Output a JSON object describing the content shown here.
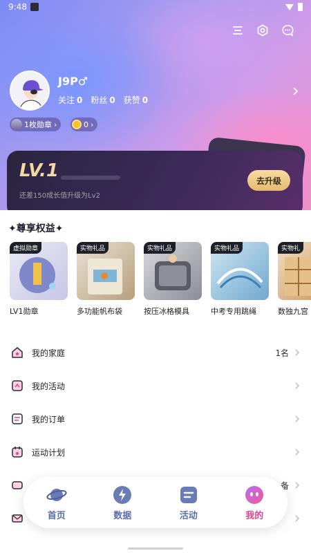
{
  "status_bar": {
    "time": "9:48"
  },
  "profile": {
    "username": "J9P♂",
    "stats": [
      {
        "label": "关注",
        "value": "0"
      },
      {
        "label": "粉丝",
        "value": "0"
      },
      {
        "label": "获赞",
        "value": "0"
      }
    ],
    "badge_pill": "1枚勋章",
    "coin_pill": "0"
  },
  "level": {
    "title": "LV.1",
    "subtitle": "还差150成长值升级为Lv2",
    "upgrade_label": "去升级"
  },
  "benefits": {
    "title": "尊享权益",
    "items": [
      {
        "tag": "虚拟勋章",
        "label": "LV1勋章",
        "color": "#7f88c9"
      },
      {
        "tag": "实物礼品",
        "label": "多功能帆布袋",
        "color": "#c9b79a"
      },
      {
        "tag": "实物礼品",
        "label": "按压冰格模具",
        "color": "#6d6f78"
      },
      {
        "tag": "实物礼品",
        "label": "中考专用跳绳",
        "color": "#7fb6d6"
      },
      {
        "tag": "实物礼",
        "label": "数独九宫",
        "color": "#d6a86a"
      }
    ]
  },
  "menu": [
    {
      "label": "我的家庭",
      "value": "1名"
    },
    {
      "label": "我的活动",
      "value": ""
    },
    {
      "label": "我的订单",
      "value": ""
    },
    {
      "label": "运动计划",
      "value": ""
    },
    {
      "label": "",
      "value": "备"
    },
    {
      "label": "",
      "value": ""
    }
  ],
  "nav": [
    {
      "label": "首页",
      "icon": "planet-icon"
    },
    {
      "label": "数据",
      "icon": "lightning-icon"
    },
    {
      "label": "活动",
      "icon": "activity-icon"
    },
    {
      "label": "我的",
      "icon": "face-icon"
    }
  ],
  "colors": {
    "accent_pink": "#e0458c",
    "nav_blue": "#5b6ea8",
    "gold": "#f5d7a0"
  }
}
